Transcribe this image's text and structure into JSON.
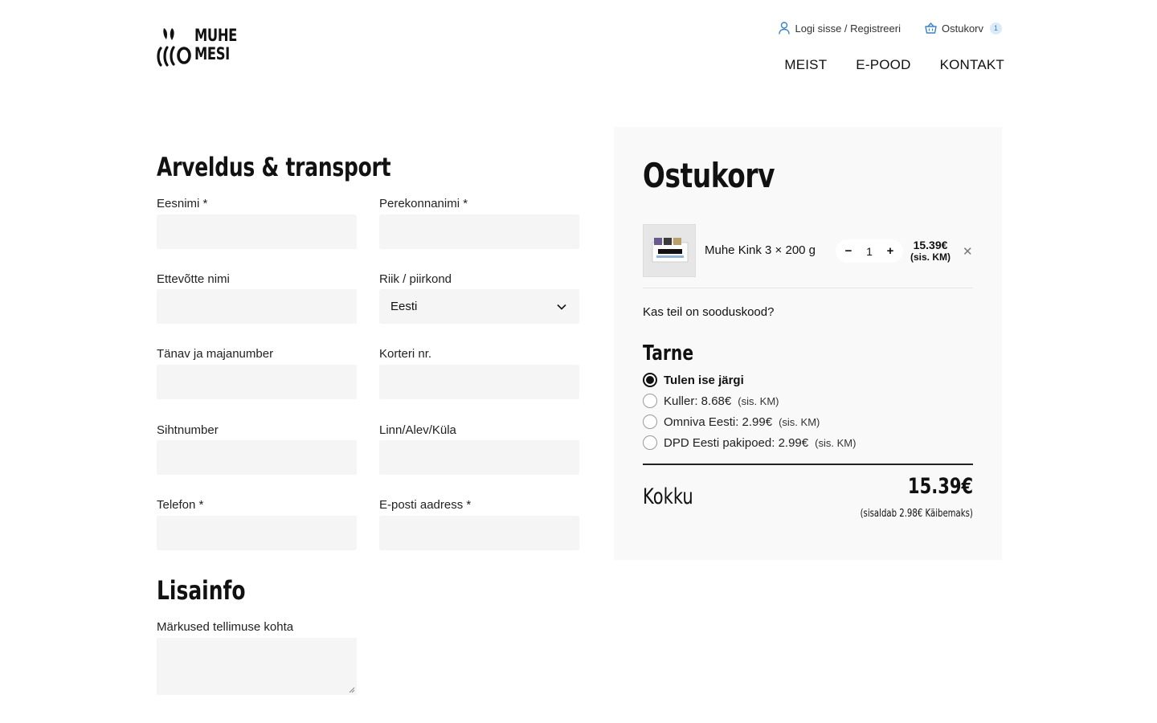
{
  "header": {
    "logo_line1": "MUHE",
    "logo_line2": "MESI",
    "login_label": "Logi sisse / Registreeri",
    "cart_label": "Ostukorv",
    "cart_count": "1",
    "nav": [
      "MEIST",
      "E-POOD",
      "KONTAKT"
    ]
  },
  "billing": {
    "title": "Arveldus & transport",
    "first_name_label": "Eesnimi *",
    "last_name_label": "Perekonnanimi *",
    "company_label": "Ettevõtte nimi",
    "country_label": "Riik / piirkond",
    "country_value": "Eesti",
    "street_label": "Tänav ja majanumber",
    "apartment_label": "Korteri nr.",
    "postcode_label": "Sihtnumber",
    "city_label": "Linn/Alev/Küla",
    "phone_label": "Telefon *",
    "email_label": "E-posti aadress *"
  },
  "extra": {
    "title": "Lisainfo",
    "notes_label": "Märkused tellimuse kohta"
  },
  "cart": {
    "title": "Ostukorv",
    "item": {
      "name": "Muhe Kink 3 × 200 g",
      "quantity": "1",
      "price": "15.39€",
      "price_note": "(sis. KM)"
    },
    "coupon_text": "Kas teil on sooduskood?",
    "shipping_title": "Tarne",
    "shipping_options": [
      {
        "label": "Tulen ise järgi",
        "note": "",
        "selected": true
      },
      {
        "label": "Kuller: 8.68€",
        "note": "(sis. KM)",
        "selected": false
      },
      {
        "label": "Omniva Eesti: 2.99€",
        "note": "(sis. KM)",
        "selected": false
      },
      {
        "label": "DPD Eesti pakipoed: 2.99€",
        "note": "(sis. KM)",
        "selected": false
      }
    ],
    "total_label": "Kokku",
    "total_value": "15.39€",
    "total_note": "(sisaldab 2.98€ Käibemaks)"
  }
}
